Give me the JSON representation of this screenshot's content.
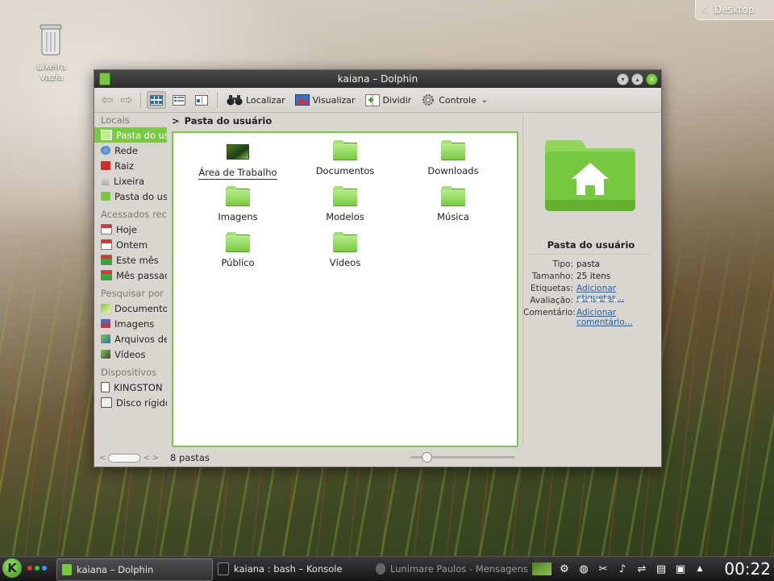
{
  "desktop": {
    "widget_label": "Desktop",
    "trash_label_line1": "Lixeira",
    "trash_label_line2": "vazia"
  },
  "window": {
    "title": "kaiana – Dolphin",
    "toolbar": {
      "find_label": "Localizar",
      "preview_label": "Visualizar",
      "split_label": "Dividir",
      "control_label": "Controle"
    },
    "places": {
      "section_places": "Locais",
      "places_items": [
        {
          "label": "Pasta do usuário",
          "icon": "home-folder-icon",
          "color": "#7ac943"
        },
        {
          "label": "Rede",
          "icon": "network-globe-icon",
          "color": "#2f6fb0"
        },
        {
          "label": "Raiz",
          "icon": "root-folder-icon",
          "color": "#d12b2b"
        },
        {
          "label": "Lixeira",
          "icon": "trash-icon",
          "color": "#9a9a9a"
        },
        {
          "label": "Pasta do usuário",
          "icon": "home-folder-icon",
          "color": "#7ac943"
        }
      ],
      "section_recent": "Acessados recentemente",
      "recent_items": [
        {
          "label": "Hoje",
          "icon": "calendar-today-icon"
        },
        {
          "label": "Ontem",
          "icon": "calendar-yesterday-icon"
        },
        {
          "label": "Este mês",
          "icon": "calendar-month-icon"
        },
        {
          "label": "Mês passado",
          "icon": "calendar-last-month-icon"
        }
      ],
      "section_search": "Pesquisar por",
      "search_items": [
        {
          "label": "Documentos",
          "icon": "documents-search-icon"
        },
        {
          "label": "Imagens",
          "icon": "images-search-icon"
        },
        {
          "label": "Arquivos de áudio",
          "icon": "audio-search-icon"
        },
        {
          "label": "Vídeos",
          "icon": "videos-search-icon"
        }
      ],
      "section_devices": "Dispositivos",
      "device_items": [
        {
          "label": "KINGSTON",
          "icon": "usb-drive-icon"
        },
        {
          "label": "Disco rígido",
          "icon": "hard-disk-icon"
        }
      ]
    },
    "breadcrumb": {
      "arrow": ">",
      "current": "Pasta do usuário"
    },
    "files": [
      {
        "name": "Área de Trabalho",
        "icon": "desktop-folder-icon"
      },
      {
        "name": "Documentos",
        "icon": "folder-icon"
      },
      {
        "name": "Downloads",
        "icon": "folder-icon"
      },
      {
        "name": "Imagens",
        "icon": "folder-icon"
      },
      {
        "name": "Modelos",
        "icon": "folder-icon"
      },
      {
        "name": "Música",
        "icon": "folder-icon"
      },
      {
        "name": "Público",
        "icon": "folder-icon"
      },
      {
        "name": "Vídeos",
        "icon": "folder-icon"
      }
    ],
    "status": {
      "summary": "8 pastas"
    },
    "info_panel": {
      "name": "Pasta do usuário",
      "type_key": "Tipo:",
      "type_value": "pasta",
      "size_key": "Tamanho:",
      "size_value": "25 itens",
      "tags_key": "Etiquetas:",
      "tags_value": "Adicionar etiquetas...",
      "rating_key": "Avaliação:",
      "rating_value": 0,
      "rating_max": 5,
      "comment_key": "Comentário:",
      "comment_value_line1": "Adicionar",
      "comment_value_line2": "comentário..."
    }
  },
  "taskbar": {
    "start_letter": "K",
    "tasks": [
      {
        "label": "kaiana – Dolphin",
        "state": "active"
      },
      {
        "label": "kaiana : bash – Konsole",
        "state": "normal"
      },
      {
        "label": "Lunimare Paulos - Mensagens",
        "state": "dim"
      }
    ],
    "clock": "00:22"
  },
  "colors": {
    "accent": "#7ac943",
    "link": "#1f62b3",
    "window_bg": "#d9d6d2",
    "titlebar": "#2d2d2d"
  }
}
